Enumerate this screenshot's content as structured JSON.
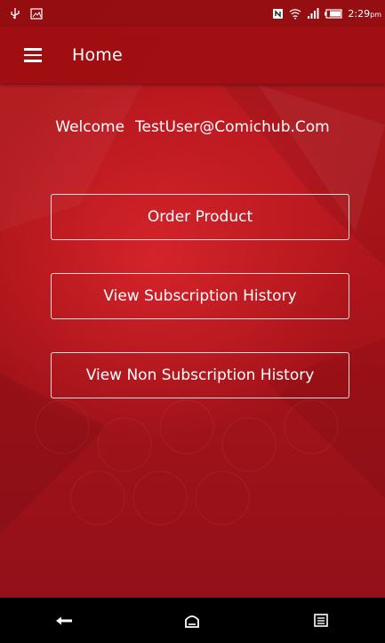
{
  "status_bar": {
    "time": "2:29",
    "time_suffix": "pm",
    "left_icons": [
      "usb-icon",
      "image-notification-icon"
    ],
    "right_icons": [
      "nfc-icon",
      "wifi-icon",
      "signal-icon",
      "battery-icon"
    ]
  },
  "app_bar": {
    "title": "Home",
    "menu_icon": "hamburger-menu-icon"
  },
  "welcome": {
    "prefix": "Welcome",
    "user": "TestUser@Comichub.Com"
  },
  "buttons": {
    "order_product": "Order Product",
    "view_subscription_history": "View Subscription History",
    "view_non_subscription_history": "View Non Subscription History"
  },
  "nav_bar": {
    "icons": [
      "back-icon",
      "home-icon",
      "recent-apps-icon"
    ]
  },
  "colors": {
    "background": "#a81318",
    "status_bar": "#780a0a",
    "nav_bar": "#000000",
    "text": "#ffffff"
  }
}
